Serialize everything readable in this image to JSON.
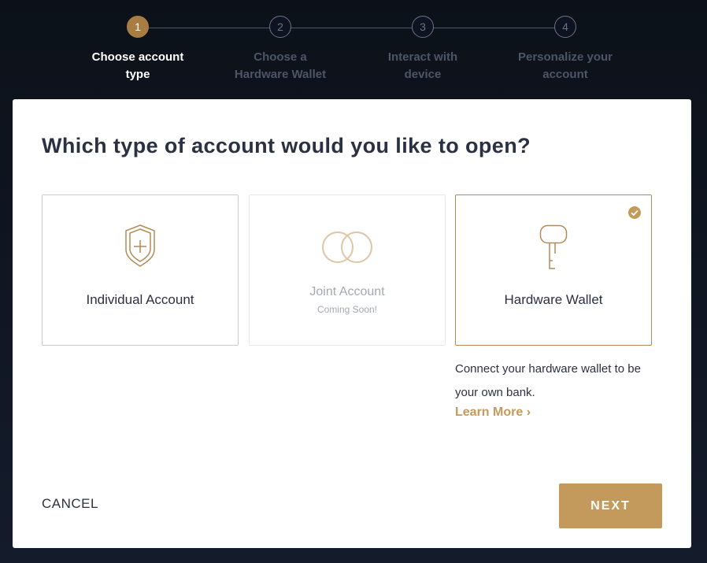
{
  "stepper": {
    "steps": [
      {
        "number": "1",
        "label": "Choose account\ntype",
        "state": "active"
      },
      {
        "number": "2",
        "label": "Choose a\nHardware Wallet",
        "state": "inactive"
      },
      {
        "number": "3",
        "label": "Interact with\ndevice",
        "state": "inactive"
      },
      {
        "number": "4",
        "label": "Personalize your\naccount",
        "state": "inactive"
      }
    ]
  },
  "modal": {
    "title": "Which type of account would you like to open?",
    "options": [
      {
        "label": "Individual Account",
        "icon": "shield-plus-icon",
        "state": "enabled"
      },
      {
        "label": "Joint Account",
        "sublabel": "Coming Soon!",
        "icon": "rings-icon",
        "state": "disabled"
      },
      {
        "label": "Hardware Wallet",
        "icon": "key-icon",
        "state": "selected"
      }
    ],
    "selected_description": "Connect your hardware wallet to be your own bank.",
    "learn_more": "Learn More ›",
    "cancel_label": "CANCEL",
    "next_label": "NEXT"
  },
  "colors": {
    "accent": "#c49a5c",
    "accent_dark": "#a87d44",
    "text": "#2b3143",
    "background": "#0d1320"
  }
}
